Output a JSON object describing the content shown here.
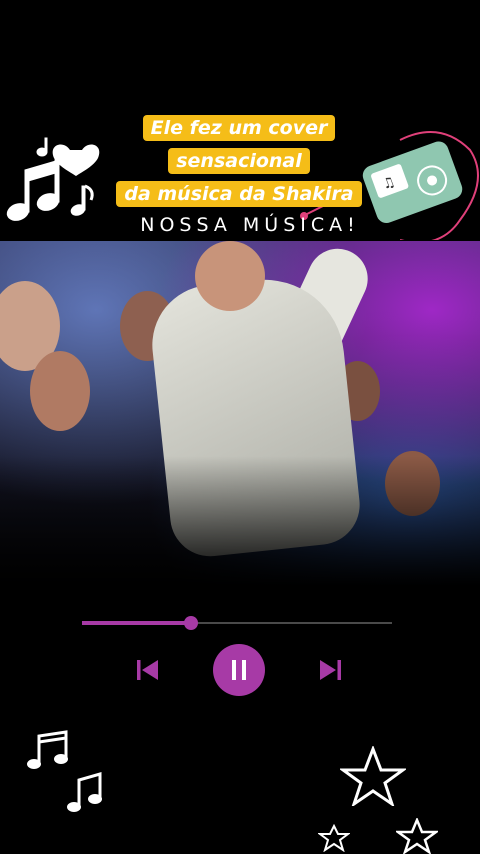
{
  "caption": {
    "line1": "Ele fez um cover sensacional",
    "line2": "da música da Shakira"
  },
  "subtitle": "NOSSA MÚSICA!",
  "player": {
    "progress": 0.35,
    "accent": "#a73aa6",
    "caption_bg": "#f5bd18"
  },
  "controls": {
    "prev": "skip-back-icon",
    "pause": "pause-icon",
    "next": "skip-forward-icon"
  }
}
